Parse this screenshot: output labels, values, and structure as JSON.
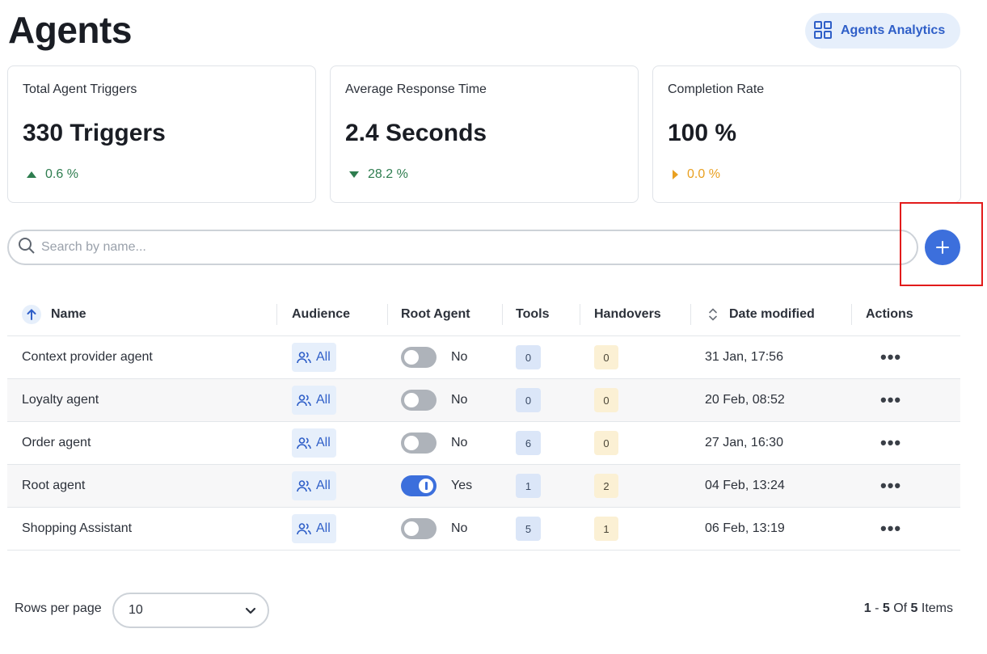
{
  "page": {
    "title": "Agents"
  },
  "header": {
    "analytics_label": "Agents Analytics",
    "analytics_icon": "grid-icon"
  },
  "stats": [
    {
      "title": "Total Agent Triggers",
      "value": "330 Triggers",
      "delta": "0.6 %",
      "trend": "up"
    },
    {
      "title": "Average Response Time",
      "value": "2.4 Seconds",
      "delta": "28.2 %",
      "trend": "down"
    },
    {
      "title": "Completion Rate",
      "value": "100 %",
      "delta": "0.0 %",
      "trend": "flat"
    }
  ],
  "search": {
    "placeholder": "Search by name...",
    "value": ""
  },
  "table": {
    "columns": [
      "Name",
      "Audience",
      "Root Agent",
      "Tools",
      "Handovers",
      "Date modified",
      "Actions"
    ],
    "rows": [
      {
        "name": "Context provider agent",
        "audience": "All",
        "root": "No",
        "tools": "0",
        "handovers": "0",
        "date": "31 Jan, 17:56"
      },
      {
        "name": "Loyalty agent",
        "audience": "All",
        "root": "No",
        "tools": "0",
        "handovers": "0",
        "date": "20 Feb, 08:52"
      },
      {
        "name": "Order agent",
        "audience": "All",
        "root": "No",
        "tools": "6",
        "handovers": "0",
        "date": "27 Jan, 16:30"
      },
      {
        "name": "Root agent",
        "audience": "All",
        "root": "Yes",
        "tools": "1",
        "handovers": "2",
        "date": "04 Feb, 13:24"
      },
      {
        "name": "Shopping Assistant",
        "audience": "All",
        "root": "No",
        "tools": "5",
        "handovers": "1",
        "date": "06 Feb, 13:19"
      }
    ],
    "actions_glyph": "•••"
  },
  "footer": {
    "rows_per_page_label": "Rows per page",
    "rows_per_page_value": "10",
    "range_start": "1",
    "range_sep": " - ",
    "range_end": "5",
    "of_label": " Of ",
    "total": "5",
    "items_label": " Items"
  },
  "colors": {
    "accent": "#3c6fdc",
    "up": "#2e7d4f",
    "down": "#2e7d4f",
    "flat": "#e9a020",
    "highlight": "#e21b1b"
  }
}
